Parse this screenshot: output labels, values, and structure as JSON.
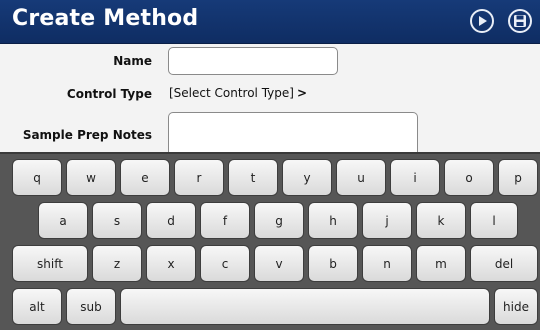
{
  "header": {
    "title": "Create Method",
    "play_icon": "play-circle-icon",
    "save_icon": "save-disk-icon"
  },
  "form": {
    "name_label": "Name",
    "name_value": "",
    "control_type_label": "Control Type",
    "control_type_value": "[Select Control Type]",
    "control_type_chevron": ">",
    "notes_label": "Sample Prep Notes",
    "notes_value": ""
  },
  "keyboard": {
    "row1": [
      "q",
      "w",
      "e",
      "r",
      "t",
      "y",
      "u",
      "i",
      "o",
      "p"
    ],
    "row2": [
      "a",
      "s",
      "d",
      "f",
      "g",
      "h",
      "j",
      "k",
      "l"
    ],
    "row3": [
      "shift",
      "z",
      "x",
      "c",
      "v",
      "b",
      "n",
      "m",
      "del"
    ],
    "row4": [
      "alt",
      "sub",
      "",
      "hide"
    ]
  },
  "colors": {
    "header_bg": "#13346f",
    "keyboard_bg": "#565656",
    "key_face": "#ececec"
  }
}
